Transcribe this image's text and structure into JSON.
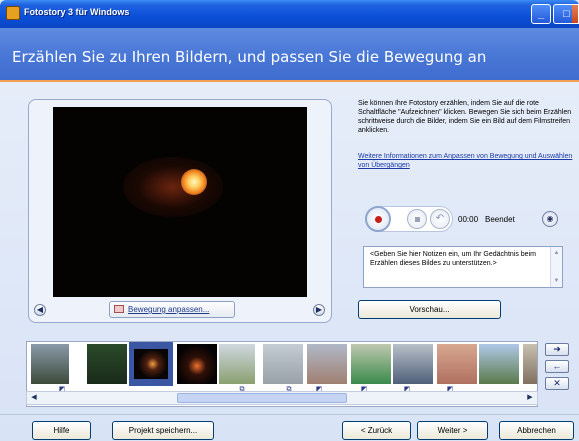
{
  "window": {
    "title": "Fotostory 3 für Windows"
  },
  "header": {
    "title": "Erzählen Sie zu Ihren Bildern, und passen Sie die Bewegung an"
  },
  "preview": {
    "motion_button": "Bewegung anpassen..."
  },
  "info": {
    "description": "Sie können Ihre Fotostory erzählen, indem Sie auf die rote Schaltfläche \"Aufzeichnen\" klicken. Bewegen Sie sich beim Erzählen schrittweise durch die Bilder, indem Sie ein Bild auf dem Filmstreifen anklicken.",
    "link": "Weitere Informationen zum Anpassen von Bewegung und Auswählen von Übergängen"
  },
  "recorder": {
    "time": "00:00",
    "status": "Beendet"
  },
  "notes": {
    "text": "<Geben Sie hier Notizen ein, um Ihr Gedächtnis beim Erzählen dieses Bildes zu unterstützen.>"
  },
  "buttons": {
    "preview": "Vorschau...",
    "help": "Hilfe",
    "save": "Projekt speichern...",
    "back": "< Zurück",
    "next": "Weiter >",
    "cancel": "Abbrechen"
  },
  "colors": {
    "accent": "#f0a050",
    "header": "#4a78d6",
    "selection": "#3b57a3"
  }
}
